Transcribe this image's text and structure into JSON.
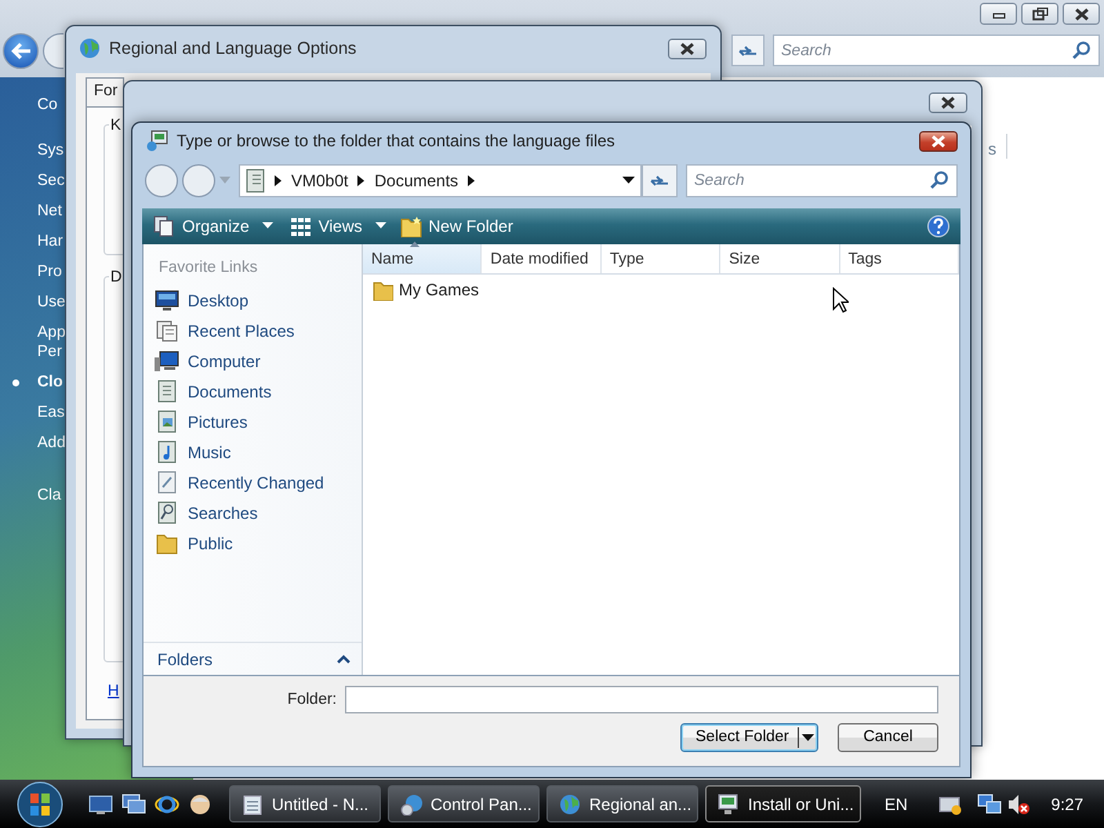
{
  "control_panel": {
    "search": {
      "placeholder": "Search"
    },
    "sidebar": [
      {
        "label": "Co",
        "selected": false
      },
      {
        "label": "Sys",
        "selected": false
      },
      {
        "label": "Sec",
        "selected": false
      },
      {
        "label": "Net",
        "selected": false
      },
      {
        "label": "Har",
        "selected": false
      },
      {
        "label": "Pro",
        "selected": false
      },
      {
        "label": "Use",
        "selected": false
      },
      {
        "label": "App Per",
        "selected": false
      },
      {
        "label": "Clo",
        "selected": true
      },
      {
        "label": "Eas",
        "selected": false
      },
      {
        "label": "Add",
        "selected": false
      },
      {
        "label": "Cla",
        "selected": false
      }
    ],
    "content_fragment": "s"
  },
  "regional_window": {
    "title": "Regional and Language Options",
    "tab": "For",
    "group_labels": [
      "K",
      "D"
    ],
    "link": "H"
  },
  "dialog": {
    "title": "Type or browse to the folder that contains the language files",
    "breadcrumbs": [
      "VM0b0t",
      "Documents"
    ],
    "search": {
      "placeholder": "Search"
    },
    "toolbar": [
      {
        "label": "Organize",
        "kind": "organize"
      },
      {
        "label": "Views",
        "kind": "views"
      },
      {
        "label": "New Folder",
        "kind": "new_folder"
      }
    ],
    "favorite_links_header": "Favorite Links",
    "favorite_links": [
      {
        "label": "Desktop",
        "kind": "monitor"
      },
      {
        "label": "Recent Places",
        "kind": "recent"
      },
      {
        "label": "Computer",
        "kind": "computer"
      },
      {
        "label": "Documents",
        "kind": "documents"
      },
      {
        "label": "Pictures",
        "kind": "pictures"
      },
      {
        "label": "Music",
        "kind": "music"
      },
      {
        "label": "Recently Changed",
        "kind": "changed"
      },
      {
        "label": "Searches",
        "kind": "searches"
      },
      {
        "label": "Public",
        "kind": "folder"
      }
    ],
    "folders_label": "Folders",
    "columns": [
      {
        "label": "Name",
        "sorted": true
      },
      {
        "label": "Date modified",
        "sorted": false
      },
      {
        "label": "Type",
        "sorted": false
      },
      {
        "label": "Size",
        "sorted": false
      },
      {
        "label": "Tags",
        "sorted": false
      }
    ],
    "items": [
      {
        "name": "My Games"
      }
    ],
    "folder_label": "Folder:",
    "buttons": [
      {
        "label": "Select Folder",
        "kind": "split"
      },
      {
        "label": "Cancel",
        "kind": "plain"
      }
    ]
  },
  "taskbar": {
    "tasks": [
      {
        "label": "Untitled - N...",
        "kind": "notepad",
        "selected": false
      },
      {
        "label": "Control Pan...",
        "kind": "control",
        "selected": false
      },
      {
        "label": "Regional an...",
        "kind": "globe",
        "selected": false
      },
      {
        "label": "Install or Uni...",
        "kind": "install",
        "selected": true
      }
    ],
    "language": "EN",
    "clock": "9:27"
  }
}
